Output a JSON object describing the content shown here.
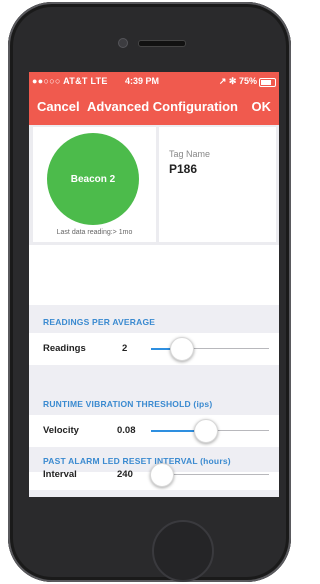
{
  "status_bar": {
    "carrier": "●●○○○ AT&T  LTE",
    "time": "4:39 PM",
    "battery_text": "↗ ✻ 75%",
    "battery_level": 0.75
  },
  "nav": {
    "cancel_label": "Cancel",
    "title": "Advanced Configuration",
    "ok_label": "OK"
  },
  "beacon": {
    "name": "Beacon 2",
    "last_reading": "Last data reading:> 1mo",
    "color": "#4cbb4b"
  },
  "tag": {
    "label": "Tag Name",
    "value": "P186"
  },
  "sections": {
    "readings": {
      "header": "READINGS PER AVERAGE",
      "label": "Readings",
      "value": "2",
      "slider_level": 0.2
    },
    "vibration": {
      "header": "RUNTIME VIBRATION THRESHOLD (ips)",
      "label": "Velocity",
      "value": "0.08",
      "slider_level": 0.45
    },
    "alarm": {
      "header": "PAST ALARM LED RESET INTERVAL (hours)",
      "label": "Interval",
      "value": "240",
      "slider_level": 0.0
    }
  },
  "colors": {
    "header_bg": "#f05a4e",
    "accent": "#3a8ad0",
    "slider_fill": "#2e8fe0"
  }
}
